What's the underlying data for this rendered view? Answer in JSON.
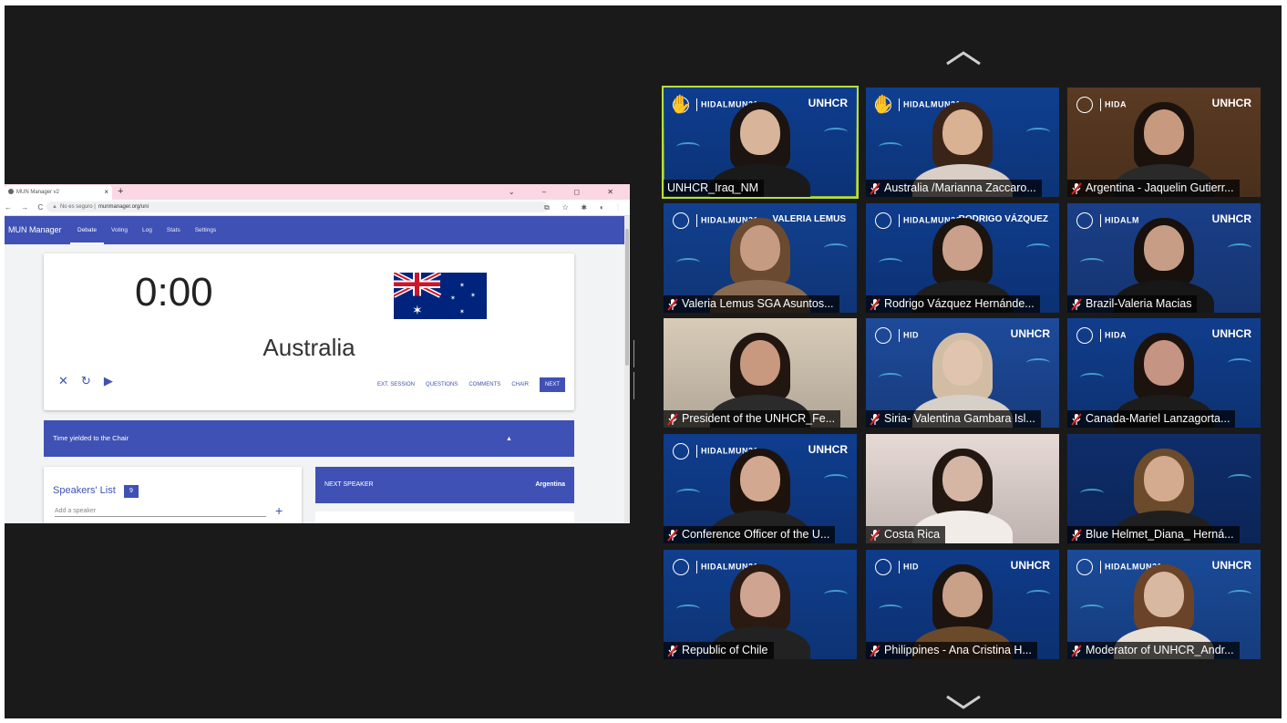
{
  "browser": {
    "tab_title": "MUN Manager v2",
    "tab_close": "×",
    "new_tab": "+",
    "window_controls": "⌄ – ◻ ✕",
    "nav_buttons": "← → C",
    "security_label": "No es seguro",
    "url": "munmanager.org/uni",
    "address_icons": "⧉ ☆ ✱ ◐ ⋮"
  },
  "app": {
    "title": "MUN Manager",
    "nav": [
      {
        "label": "Debate",
        "active": true
      },
      {
        "label": "Voting",
        "active": false
      },
      {
        "label": "Log",
        "active": false
      },
      {
        "label": "Stats",
        "active": false
      },
      {
        "label": "Settings",
        "active": false
      }
    ],
    "timer": {
      "time": "0:00",
      "country": "Australia",
      "controls": {
        "close": "✕",
        "reset": "↻",
        "play": "▶"
      },
      "actions": [
        "EXT. SESSION",
        "QUESTIONS",
        "COMMENTS",
        "CHAIR"
      ],
      "next_label": "NEXT"
    },
    "yield_message": "Time yielded to the Chair",
    "speakers": {
      "title": "Speakers' List",
      "count": "9",
      "placeholder": "Add a speaker",
      "add": "+"
    },
    "next_speaker": {
      "label": "NEXT SPEAKER",
      "value": "Argentina"
    }
  },
  "participants": [
    {
      "name": "UNHCR_Iraq_NM",
      "active": true,
      "hand_raised": true,
      "muted": false,
      "org": "UNHCR",
      "banner": "HIDALMUN21"
    },
    {
      "name": "Australia /Marianna Zaccaro...",
      "active": false,
      "hand_raised": true,
      "muted": true,
      "org": "",
      "banner": "HIDALMUN21"
    },
    {
      "name": "Argentina - Jaquelin Gutierr...",
      "active": false,
      "hand_raised": false,
      "muted": true,
      "org": "UNHCR",
      "banner": "HIDA"
    },
    {
      "name": "Valeria Lemus SGA Asuntos...",
      "active": false,
      "hand_raised": false,
      "muted": true,
      "org": "",
      "banner": "HIDALMUN21",
      "side": "VALERIA LEMUS"
    },
    {
      "name": "Rodrigo Vázquez Hernánde...",
      "active": false,
      "hand_raised": false,
      "muted": true,
      "org": "",
      "banner": "HIDALMUN21",
      "side": "RODRIGO VÁZQUEZ"
    },
    {
      "name": "Brazil-Valeria Macias",
      "active": false,
      "hand_raised": false,
      "muted": true,
      "org": "UNHCR",
      "banner": "HIDALM"
    },
    {
      "name": "President of the UNHCR_Fe...",
      "active": false,
      "hand_raised": false,
      "muted": true,
      "org": "",
      "banner": ""
    },
    {
      "name": "Siria- Valentina Gambara Isl...",
      "active": false,
      "hand_raised": false,
      "muted": true,
      "org": "UNHCR",
      "banner": "HID"
    },
    {
      "name": "Canada-Mariel Lanzagorta...",
      "active": false,
      "hand_raised": false,
      "muted": true,
      "org": "UNHCR",
      "banner": "HIDA"
    },
    {
      "name": "Conference Officer of the U...",
      "active": false,
      "hand_raised": false,
      "muted": true,
      "org": "UNHCR",
      "banner": "HIDALMUN21"
    },
    {
      "name": "Costa Rica",
      "active": false,
      "hand_raised": false,
      "muted": true,
      "org": "",
      "banner": ""
    },
    {
      "name": "Blue Helmet_Diana_ Herná...",
      "active": false,
      "hand_raised": false,
      "muted": true,
      "org": "",
      "banner": ""
    },
    {
      "name": "Republic of Chile",
      "active": false,
      "hand_raised": false,
      "muted": true,
      "org": "",
      "banner": "HIDALMUN21"
    },
    {
      "name": "Philippines -  Ana Cristina H...",
      "active": false,
      "hand_raised": false,
      "muted": true,
      "org": "UNHCR",
      "banner": "HID"
    },
    {
      "name": "Moderator of UNHCR_Andr...",
      "active": false,
      "hand_raised": false,
      "muted": true,
      "org": "UNHCR",
      "banner": "HIDALMUN21"
    }
  ],
  "colors": {
    "app_primary": "#3f51b5",
    "stage_bg": "#1a1a1a",
    "active_speaker_border": "#b7e03a",
    "tile_blue": "#0d3a86",
    "mute_red": "#e02020"
  },
  "icons": {
    "scroll_up": "chevron-up-icon",
    "scroll_down": "chevron-down-icon",
    "raised_hand": "✋",
    "muted_mic": "mic-muted-icon"
  }
}
